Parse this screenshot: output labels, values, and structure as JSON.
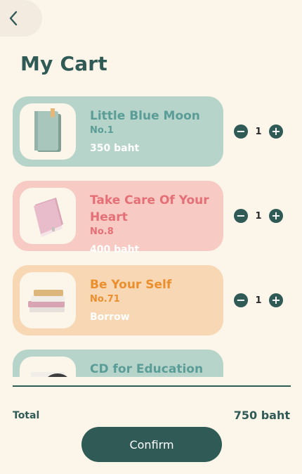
{
  "header": {
    "title": "My Cart",
    "back_icon": "chevron-left-icon"
  },
  "cart": {
    "items": [
      {
        "title": "Little Blue Moon",
        "no": "No.1",
        "price": "350 baht",
        "qty": "1",
        "bg": "#b7d4cb",
        "text_color": "#5a9d97",
        "icon": "green-notebook-icon"
      },
      {
        "title": "Take Care Of Your Heart",
        "no": "No.8",
        "price": "400 baht",
        "qty": "1",
        "bg": "#f7cbc3",
        "text_color": "#e46f76",
        "icon": "pink-book-icon"
      },
      {
        "title": "Be Your Self",
        "no": "No.71",
        "price": "Borrow",
        "qty": "1",
        "bg": "#f8d8b4",
        "text_color": "#eb8f2e",
        "icon": "book-stack-icon"
      },
      {
        "title": "CD for Education",
        "no": "",
        "price": "",
        "qty": "",
        "bg": "#b7d4cb",
        "text_color": "#5a9d97",
        "icon": "cd-icon"
      }
    ]
  },
  "summary": {
    "total_label": "Total",
    "total_value": "750 baht"
  },
  "actions": {
    "confirm_label": "Confirm"
  },
  "colors": {
    "primary": "#2f5a56",
    "background": "#fcf5ea"
  }
}
